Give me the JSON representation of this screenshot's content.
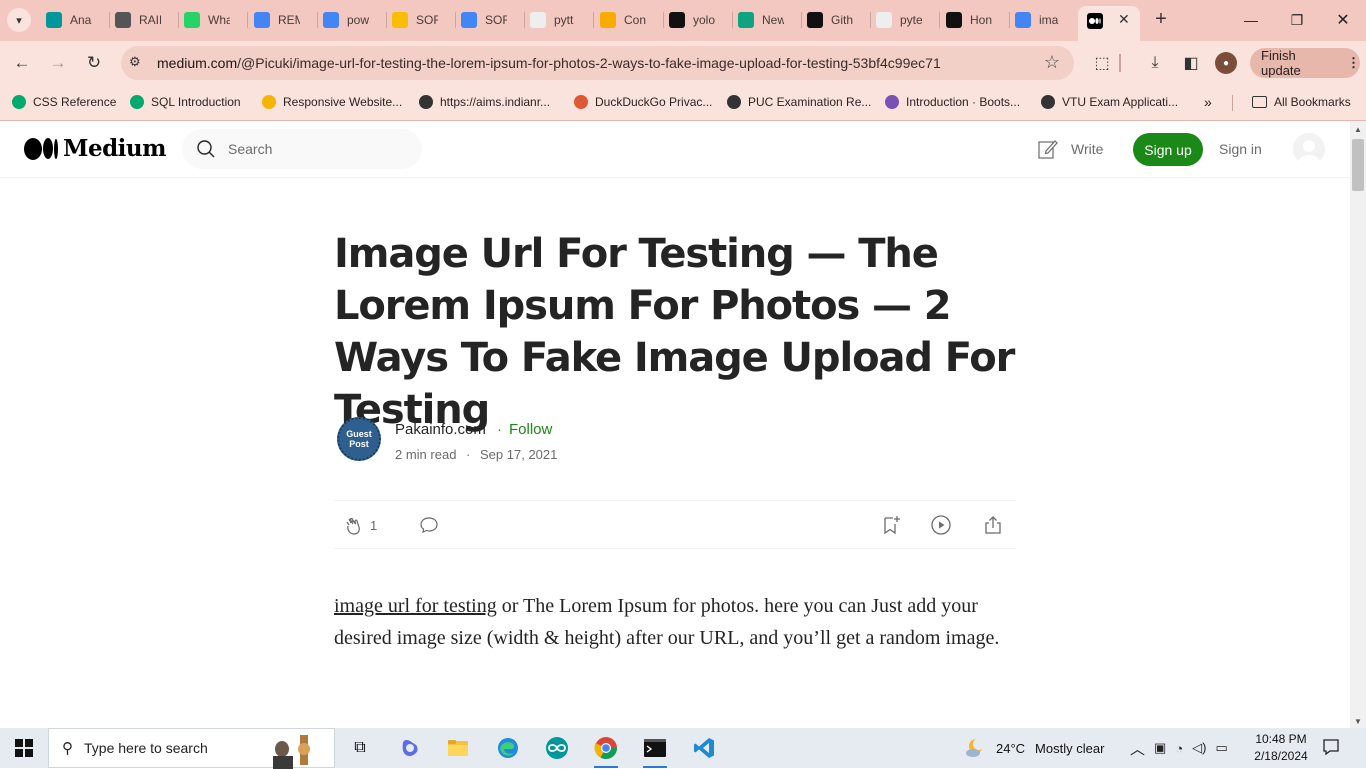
{
  "browser": {
    "tabs": [
      {
        "label": "Ana",
        "icon": "arduino-icon",
        "color": "#00979c"
      },
      {
        "label": "RAIN",
        "icon": "globe-icon",
        "color": "#555555"
      },
      {
        "label": "Wha",
        "icon": "whatsapp-icon",
        "color": "#25d366"
      },
      {
        "label": "REM",
        "icon": "docs-icon",
        "color": "#4285f4"
      },
      {
        "label": "pow",
        "icon": "docs-icon",
        "color": "#4285f4"
      },
      {
        "label": "SOF",
        "icon": "drive-icon",
        "color": "#fbbc04"
      },
      {
        "label": "SOF",
        "icon": "docs-icon",
        "color": "#4285f4"
      },
      {
        "label": "pytt",
        "icon": "cube-icon",
        "color": "#eeeeee"
      },
      {
        "label": "Con",
        "icon": "colab-icon",
        "color": "#f9ab00"
      },
      {
        "label": "yolo",
        "icon": "github-icon",
        "color": "#111111"
      },
      {
        "label": "New",
        "icon": "chatgpt-icon",
        "color": "#10a37f"
      },
      {
        "label": "Gith",
        "icon": "github-icon",
        "color": "#111111"
      },
      {
        "label": "pyte",
        "icon": "cube-icon",
        "color": "#eeeeee"
      },
      {
        "label": "Hon",
        "icon": "github-icon",
        "color": "#111111"
      },
      {
        "label": "ima",
        "icon": "google-icon",
        "color": "#4285f4"
      }
    ],
    "active_tab_icon": "medium-icon",
    "url_host": "medium.com",
    "url_path": "/@Picuki/image-url-for-testing-the-lorem-ipsum-for-photos-2-ways-to-fake-image-upload-for-testing-53bf4c99ec71",
    "finish_update": "Finish update",
    "bookmarks": [
      {
        "label": "CSS Reference",
        "icon": "w3schools-icon"
      },
      {
        "label": "SQL Introduction",
        "icon": "w3schools-icon"
      },
      {
        "label": "Responsive Website...",
        "icon": "meet-icon"
      },
      {
        "label": "https://aims.indianr...",
        "icon": "globe-icon"
      },
      {
        "label": "DuckDuckGo Privac...",
        "icon": "duckduckgo-icon"
      },
      {
        "label": "PUC Examination Re...",
        "icon": "globe-icon"
      },
      {
        "label": "Introduction · Boots...",
        "icon": "bootstrap-icon"
      },
      {
        "label": "VTU Exam Applicati...",
        "icon": "globe-icon"
      }
    ],
    "all_bookmarks": "All Bookmarks"
  },
  "medium": {
    "logo_text": "Medium",
    "search_placeholder": "Search",
    "write_label": "Write",
    "signup_label": "Sign up",
    "signin_label": "Sign in"
  },
  "article": {
    "title": "Image Url For Testing — The Lorem Ipsum For Photos — 2 Ways To Fake Image Upload For Testing",
    "author_badge_line1": "Guest",
    "author_badge_line2": "Post",
    "author_name": "Pakainfo.com",
    "separator": "·",
    "follow_label": "Follow",
    "read_time": "2 min read",
    "date": "Sep 17, 2021",
    "clap_count": "1",
    "body_link": "image url for testing",
    "body_rest": " or The Lorem Ipsum for photos. here you can Just add your desired image size (width & height) after our URL, and you’ll get a random image."
  },
  "taskbar": {
    "search_placeholder": "Type here to search",
    "temperature": "24°C",
    "weather": "Mostly clear",
    "time": "10:48 PM",
    "date": "2/18/2024"
  }
}
